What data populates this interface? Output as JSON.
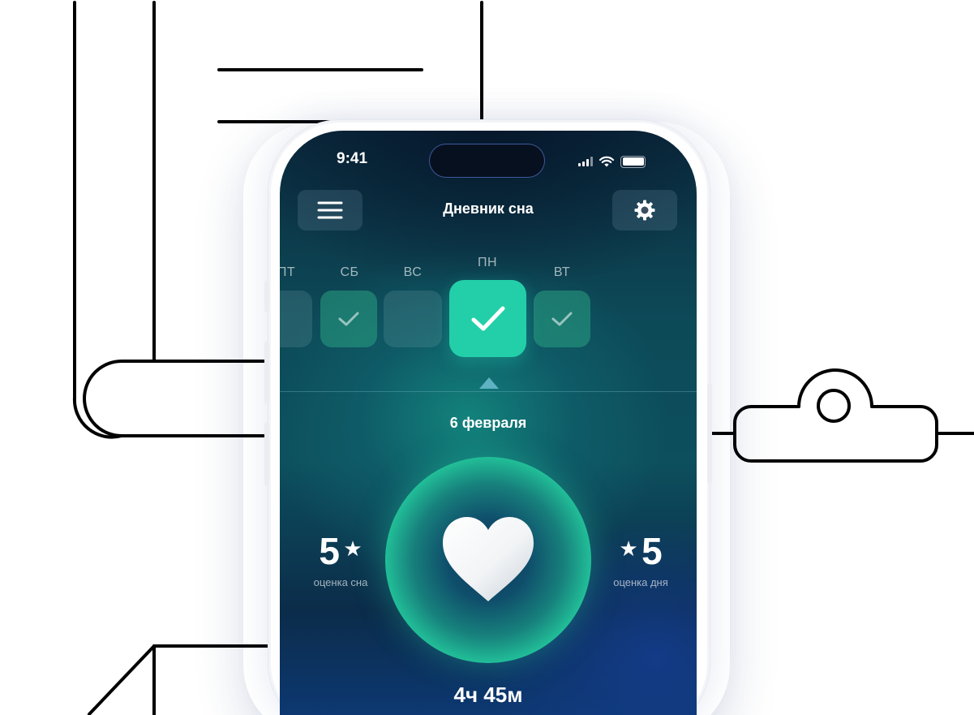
{
  "status_bar": {
    "time": "9:41"
  },
  "header": {
    "title": "Дневник сна"
  },
  "week": {
    "days": [
      {
        "label": "ПТ",
        "state": "empty"
      },
      {
        "label": "СБ",
        "state": "done"
      },
      {
        "label": "ВС",
        "state": "empty"
      },
      {
        "label": "ПН",
        "state": "current"
      },
      {
        "label": "ВТ",
        "state": "done"
      }
    ]
  },
  "selected_date": "6 февраля",
  "sleep_score": {
    "value": "5",
    "star": "★",
    "caption": "оценка сна"
  },
  "day_score": {
    "value": "5",
    "star": "★",
    "caption": "оценка дня"
  },
  "sleep_duration": "4ч 45м",
  "icons": [
    "menu-icon",
    "gear-icon",
    "check-icon",
    "heart-icon",
    "signal-icon",
    "wifi-icon",
    "battery-icon"
  ],
  "colors": {
    "accent": "#23cfa8",
    "background_dark": "#0b2a3e"
  }
}
